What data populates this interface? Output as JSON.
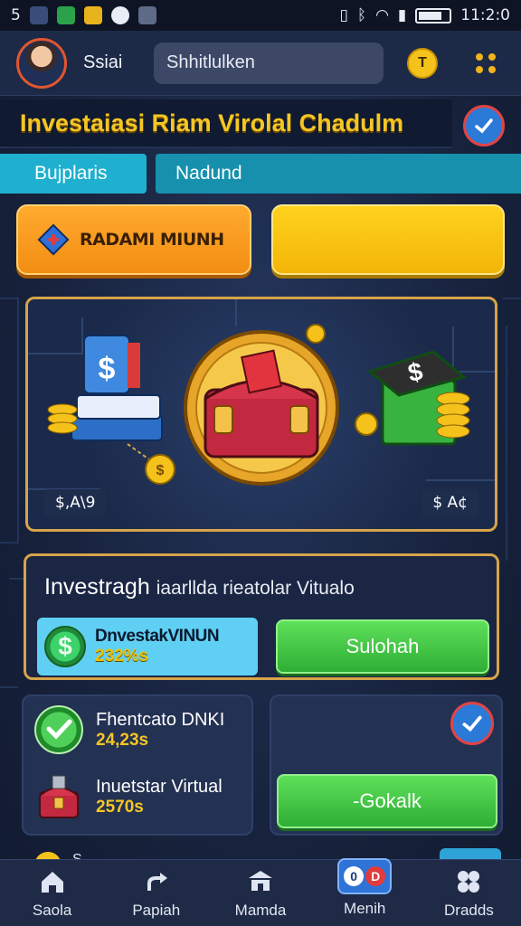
{
  "status_bar": {
    "left_text": "5",
    "time": "11:2:0"
  },
  "header": {
    "user_name": "Ssiai",
    "search_placeholder": "Shhitlulken",
    "coin_label": "T"
  },
  "title_bar": {
    "title": "Investaiasi Riam Virolal Chadulm"
  },
  "tabs": [
    {
      "label": "Bujplaris"
    },
    {
      "label": "Nadund"
    }
  ],
  "action_buttons": {
    "primary_label": "RADAMI MIUNH",
    "secondary_label": ""
  },
  "hero": {
    "left_label": "$,A\\9",
    "right_label": "$ A¢"
  },
  "invest_panel": {
    "title_main": "Investragh",
    "title_sub": "iaarllda rieatolar Vitualo",
    "card": {
      "name": "DnvestakVINUN",
      "value": "232%s"
    },
    "button_label": "Sulohah"
  },
  "cards": [
    {
      "name": "Fhentcato DNKI",
      "value": "24,23s"
    },
    {
      "name": "Inuetstar Virtual",
      "value": "2570s"
    }
  ],
  "right_card": {
    "button_label": "-Gokalk"
  },
  "peek": {
    "text": "S"
  },
  "bottom_nav": [
    {
      "label": "Saola"
    },
    {
      "label": "Papiah"
    },
    {
      "label": "Mamda"
    },
    {
      "label": "Menih",
      "badge_left": "0",
      "badge_right": "D"
    },
    {
      "label": "Dradds"
    }
  ],
  "colors": {
    "accent_gold": "#f5c625",
    "tab_cyan": "#1fb0cf",
    "button_green": "#2fae35",
    "button_orange": "#f28d13",
    "background": "#1a2540"
  }
}
